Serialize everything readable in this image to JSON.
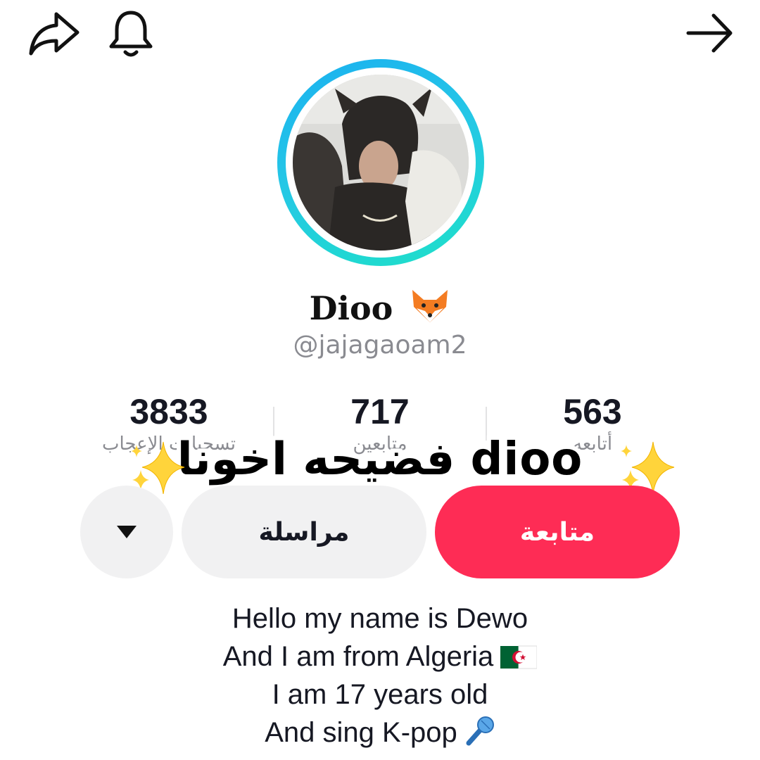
{
  "header": {
    "icons": [
      "share-arrow-icon",
      "bell-icon",
      "forward-arrow-icon"
    ]
  },
  "profile": {
    "display_name": "Dioo",
    "name_emoji": "fox-face-icon",
    "username": "@jajagaoam2"
  },
  "stats": [
    {
      "value": "3833",
      "label": "تسجيلات الإعجاب"
    },
    {
      "value": "717",
      "label": "متابعين"
    },
    {
      "value": "563",
      "label": "أتابعه"
    }
  ],
  "overlay": {
    "caption": "فضيحه اخونا dioo",
    "decoration": "sparkles-icon"
  },
  "actions": {
    "follow_label": "متابعة",
    "message_label": "مراسلة",
    "more_icon": "triangle-down-icon"
  },
  "bio": {
    "lines": [
      "Hello my name is Dewo",
      "And I am from Algeria",
      "I am 17 years old",
      "And sing K-pop"
    ],
    "line2_icon": "algeria-flag-icon",
    "line4_icon": "microphone-icon"
  },
  "colors": {
    "follow_button": "#fe2c55",
    "secondary_button": "#f1f1f2",
    "ring_start": "#1ab0f0",
    "ring_end": "#1ee0c8",
    "muted_text": "#8a8b91"
  }
}
